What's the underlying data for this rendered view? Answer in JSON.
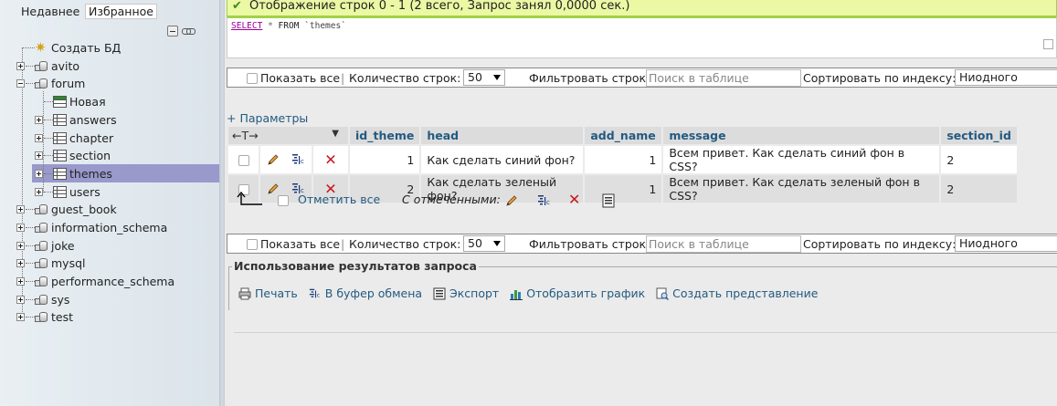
{
  "sidebar": {
    "tabs": [
      "Недавнее",
      "Избранное"
    ],
    "create_db": "Создать БД",
    "databases": [
      {
        "name": "avito",
        "expanded": false
      },
      {
        "name": "forum",
        "expanded": true
      },
      {
        "name": "guest_book",
        "expanded": false
      },
      {
        "name": "information_schema",
        "expanded": false
      },
      {
        "name": "joke",
        "expanded": false
      },
      {
        "name": "mysql",
        "expanded": false
      },
      {
        "name": "performance_schema",
        "expanded": false
      },
      {
        "name": "sys",
        "expanded": false
      },
      {
        "name": "test",
        "expanded": false
      }
    ],
    "forum_children": [
      {
        "name": "Новая",
        "kind": "new"
      },
      {
        "name": "answers",
        "kind": "table"
      },
      {
        "name": "chapter",
        "kind": "table"
      },
      {
        "name": "section",
        "kind": "table"
      },
      {
        "name": "themes",
        "kind": "table",
        "selected": true
      },
      {
        "name": "users",
        "kind": "table"
      }
    ]
  },
  "message": "Отображение строк 0 - 1 (2 всего, Запрос занял 0,0000 сек.)",
  "sql": {
    "select": "SELECT",
    "star": "*",
    "from": "FROM",
    "table": "`themes`"
  },
  "navbar": {
    "show_all": "Показать все",
    "sep": "|",
    "row_count_label": "Количество строк:",
    "row_count_value": "50",
    "filter_label": "Фильтровать строки:",
    "filter_placeholder": "Поиск в таблице",
    "sort_label": "Сортировать по индексу:",
    "sort_value": "Ниодного"
  },
  "params_link": "+ Параметры",
  "table": {
    "columns": [
      "id_theme",
      "head",
      "add_name",
      "message",
      "section_id"
    ],
    "rows": [
      {
        "id_theme": "1",
        "head": "Как сделать синий фон?",
        "add_name": "1",
        "message": "Всем привет. Как сделать синий фон в CSS?",
        "section_id": "2"
      },
      {
        "id_theme": "2",
        "head": "Как сделать зеленый фон?",
        "add_name": "1",
        "message": "Всем привет. Как сделать зеленый фон в CSS?",
        "section_id": "2"
      }
    ]
  },
  "with_selected": {
    "check_all": "Отметить все",
    "label": "С отмеченными:"
  },
  "query_results": {
    "legend": "Использование результатов запроса",
    "print": "Печать",
    "clipboard": "В буфер обмена",
    "export": "Экспорт",
    "chart": "Отобразить график",
    "view": "Создать представление"
  },
  "colors": {
    "accent_link": "#235a81",
    "selected_tree": "#9999cc",
    "success_bg": "#ebf8a4",
    "delete_red": "#c8161e"
  }
}
